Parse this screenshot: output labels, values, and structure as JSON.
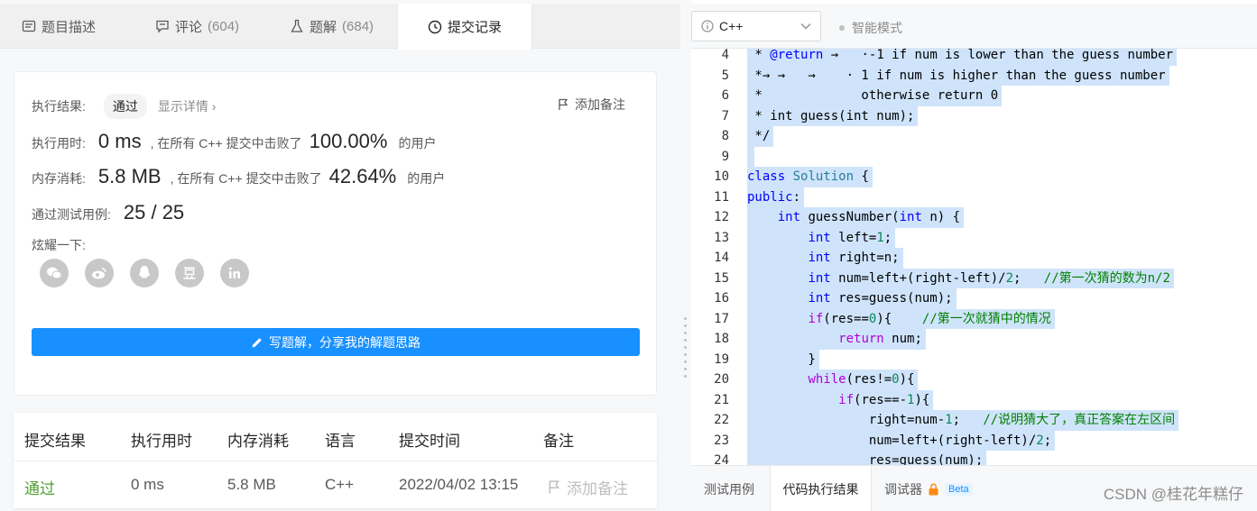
{
  "tabs": [
    {
      "label": "题目描述",
      "count": ""
    },
    {
      "label": "评论",
      "count": "(604)"
    },
    {
      "label": "题解",
      "count": "(684)"
    },
    {
      "label": "提交记录",
      "count": ""
    }
  ],
  "result": {
    "label": "执行结果:",
    "status": "通过",
    "detail": "显示详情 ›",
    "add_note": "添加备注",
    "runtime_label": "执行用时:",
    "runtime_value": "0 ms",
    "runtime_mid": ", 在所有 C++ 提交中击败了",
    "runtime_pct": "100.00%",
    "runtime_tail": "的用户",
    "memory_label": "内存消耗:",
    "memory_value": "5.8 MB",
    "memory_mid": ", 在所有 C++ 提交中击败了",
    "memory_pct": "42.64%",
    "memory_tail": "的用户",
    "tests_label": "通过测试用例:",
    "tests_value": "25 / 25",
    "share_label": "炫耀一下:",
    "share_icons": [
      "wechat-icon",
      "weibo-icon",
      "qq-icon",
      "douban-icon",
      "linkedin-icon"
    ],
    "write_button": "写题解，分享我的解题思路"
  },
  "table": {
    "headers": [
      "提交结果",
      "执行用时",
      "内存消耗",
      "语言",
      "提交时间",
      "备注"
    ],
    "row": {
      "status": "通过",
      "runtime": "0 ms",
      "memory": "5.8 MB",
      "language": "C++",
      "time": "2022/04/02 13:15",
      "note": "添加备注"
    }
  },
  "editor": {
    "language": "C++",
    "mode": "智能模式",
    "lines": [
      {
        "n": "4"
      },
      {
        "n": "5"
      },
      {
        "n": "6"
      },
      {
        "n": "7"
      },
      {
        "n": "8"
      },
      {
        "n": "9"
      },
      {
        "n": "10"
      },
      {
        "n": "11"
      },
      {
        "n": "12"
      },
      {
        "n": "13"
      },
      {
        "n": "14"
      },
      {
        "n": "15"
      },
      {
        "n": "16"
      },
      {
        "n": "17"
      },
      {
        "n": "18"
      },
      {
        "n": "19"
      },
      {
        "n": "20"
      },
      {
        "n": "21"
      },
      {
        "n": "22"
      },
      {
        "n": "23"
      },
      {
        "n": "24"
      }
    ]
  },
  "bottom_tabs": [
    "测试用例",
    "代码执行结果",
    "调试器"
  ],
  "beta": "Beta",
  "watermark": "CSDN @桂花年糕仔",
  "colors": {
    "accent": "#1890ff",
    "pass": "#52a033",
    "selection": "#cfe4fb"
  }
}
